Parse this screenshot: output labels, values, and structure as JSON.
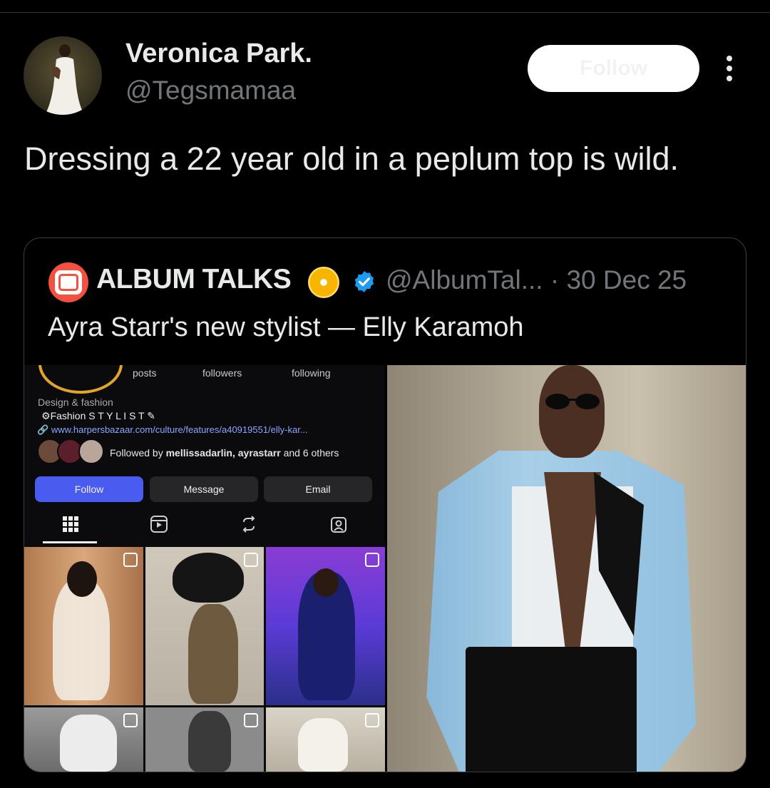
{
  "tweet": {
    "author_name": "Veronica Park.",
    "author_handle": "@Tegsmamaa",
    "follow_label": "Follow",
    "text": "Dressing a 22 year old in a peplum top is wild."
  },
  "quoted_tweet": {
    "author_name": "ALBUM TALKS",
    "author_handle": "@AlbumTal...",
    "separator_date": "· 30 Dec 25",
    "text": "Ayra Starr's new stylist — Elly Karamoh",
    "verified": true
  },
  "instagram_screenshot": {
    "stats": [
      "posts",
      "followers",
      "following"
    ],
    "bio_category": "Design & fashion",
    "bio_line": "Fashion S T Y L I S T",
    "link": "www.harpersbazaar.com/culture/features/a40919551/elly-kar...",
    "followed_by_prefix": "Followed by ",
    "followed_by_names": "mellissadarlin, ayrastarr",
    "followed_by_suffix": " and 6 others",
    "buttons": [
      "Follow",
      "Message",
      "Email"
    ]
  },
  "colors": {
    "background": "#000000",
    "text_primary": "#e7e9ea",
    "text_secondary": "#71767b",
    "verified_blue": "#1d9bf0",
    "ig_follow_blue": "#4a5cf0"
  }
}
